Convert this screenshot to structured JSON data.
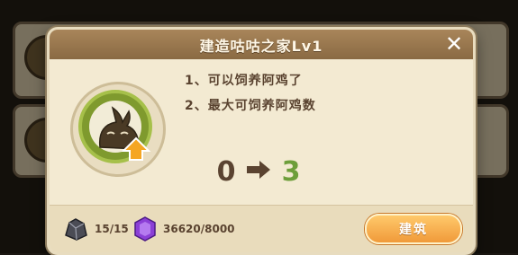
{
  "dialog": {
    "title": "建造咕咕之家Lv1",
    "close_icon": "close-icon",
    "building_icon": "rabbit-house-icon",
    "upgrade_icon": "upgrade-arrow-icon"
  },
  "features": [
    "1、可以饲养阿鸡了",
    "2、最大可饲养阿鸡数"
  ],
  "capacity": {
    "from": "0",
    "to": "3",
    "arrow_icon": "right-arrow-icon"
  },
  "resources": [
    {
      "icon": "ore-icon",
      "value": "15/15"
    },
    {
      "icon": "purple-gem-icon",
      "value": "36620/8000"
    }
  ],
  "actions": {
    "build_label": "建筑"
  },
  "colors": {
    "accent_green": "#6d9e3a",
    "title_bar": "#9a7850",
    "button_orange": "#f5a948"
  }
}
